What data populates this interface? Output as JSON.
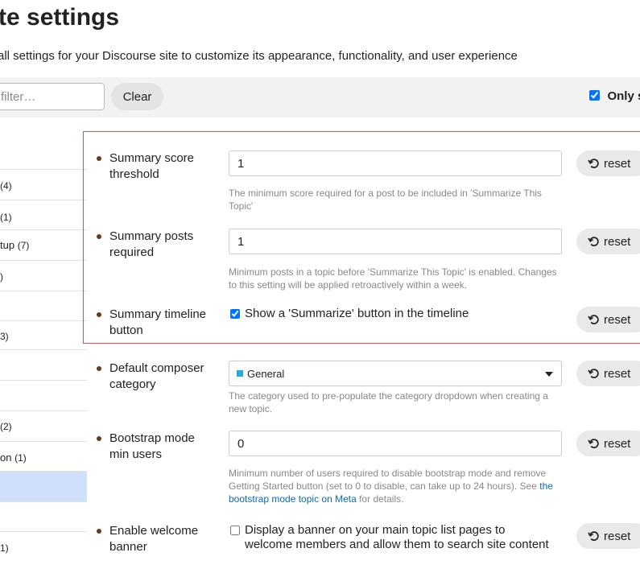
{
  "page": {
    "title": "te settings",
    "subtitle": "all settings for your Discourse site to customize its appearance, functionality, and user experience"
  },
  "toolbar": {
    "filter_placeholder": "filter…",
    "clear_label": "Clear",
    "only_label": "Only s",
    "only_checked": true
  },
  "sidebar": {
    "items": [
      {
        "label": "",
        "count": "(4)"
      },
      {
        "label": "",
        "count": "(1)"
      },
      {
        "label": "tup",
        "count": "(7)"
      },
      {
        "label": "",
        "count": ")"
      },
      {
        "label": "",
        "count": ""
      },
      {
        "label": "",
        "count": "3)"
      },
      {
        "label": "",
        "count": ""
      },
      {
        "label": "",
        "count": ""
      },
      {
        "label": "",
        "count": "(2)"
      },
      {
        "label": "on",
        "count": "(1)"
      },
      {
        "label": "",
        "count": ""
      },
      {
        "label": "",
        "count": ""
      },
      {
        "label": "",
        "count": "1)"
      }
    ]
  },
  "settings": {
    "reset_label": "reset",
    "summary_score": {
      "name": "Summary score threshold",
      "value": "1",
      "description": "The minimum score required for a post to be included in 'Summarize This Topic'"
    },
    "summary_posts": {
      "name": "Summary posts required",
      "value": "1",
      "description": "Minimum posts in a topic before 'Summarize This Topic' is enabled. Changes to this setting will be applied retroactively within a week."
    },
    "summary_timeline": {
      "name": "Summary timeline button",
      "checkbox_label": "Show a 'Summarize' button in the timeline",
      "checked": true
    },
    "default_composer": {
      "name": "Default composer category",
      "selected": "General",
      "swatch_color": "#25aae1",
      "description": "The category used to pre-populate the category dropdown when creating a new topic."
    },
    "bootstrap_mode": {
      "name": "Bootstrap mode min users",
      "value": "0",
      "description_before": "Minimum number of users required to disable bootstrap mode and remove Getting Started button (set to 0 to disable, can take up to 24 hours). See ",
      "link_text": "the bootstrap mode topic on Meta",
      "description_after": " for details."
    },
    "welcome_banner": {
      "name": "Enable welcome banner",
      "checkbox_label": "Display a banner on your main topic list pages to welcome members and allow them to search site content",
      "checked": false
    }
  },
  "colors": {
    "highlight_border": "#d9534f",
    "active_nav": "#cfe0fb",
    "link": "#0a69b5",
    "bullet": "#6b3a1e"
  }
}
